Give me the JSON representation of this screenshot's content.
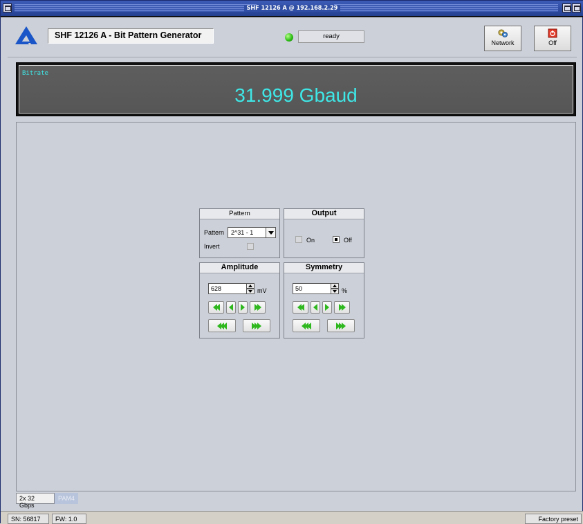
{
  "window": {
    "title": "SHF 12126 A @ 192.168.2.29"
  },
  "header": {
    "app_title": "SHF 12126 A - Bit Pattern Generator",
    "status": "ready",
    "status_color": "#2fbf17",
    "network_label": "Network",
    "off_label": "Off"
  },
  "bitrate": {
    "label": "Bitrate",
    "value": "31.999 Gbaud",
    "color": "#3fe7e7"
  },
  "pattern": {
    "header": "Pattern",
    "pattern_label": "Pattern",
    "pattern_value": "2^31 - 1",
    "invert_label": "Invert",
    "invert_checked": false
  },
  "output": {
    "header": "Output",
    "on_label": "On",
    "off_label": "Off",
    "selected": "Off"
  },
  "amplitude": {
    "header": "Amplitude",
    "value": "628",
    "unit": "mV"
  },
  "symmetry": {
    "header": "Symmetry",
    "value": "50",
    "unit": "%"
  },
  "tabs": [
    {
      "label": "2x 32 Gbps",
      "active": true
    },
    {
      "label": "PAM4",
      "active": false
    }
  ],
  "statusbar": {
    "sn": "SN: 56817",
    "fw": "FW: 1.0",
    "preset": "Factory preset"
  }
}
